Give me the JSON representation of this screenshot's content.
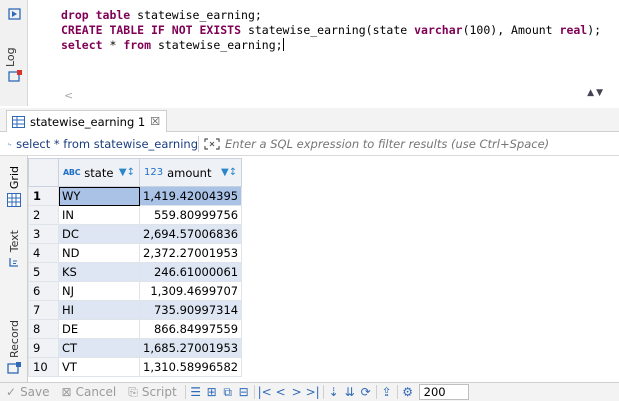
{
  "editor": {
    "lines": [
      [
        {
          "t": "drop table",
          "k": true
        },
        {
          "t": " statewise_earning;",
          "k": false
        }
      ],
      [
        {
          "t": "CREATE TABLE IF NOT EXISTS",
          "k": true
        },
        {
          "t": " statewise_earning(state ",
          "k": false
        },
        {
          "t": "varchar",
          "k": true
        },
        {
          "t": "(100), Amount ",
          "k": false
        },
        {
          "t": "real",
          "k": true
        },
        {
          "t": ");",
          "k": false
        }
      ],
      [
        {
          "t": "select",
          "k": true
        },
        {
          "t": " * ",
          "k": false
        },
        {
          "t": "from",
          "k": true
        },
        {
          "t": " statewise_earning;",
          "k": false
        }
      ]
    ],
    "log_tab": "Log"
  },
  "result_tab": {
    "label": "statewise_earning 1",
    "close_icon": "close-icon"
  },
  "filter_bar": {
    "query": "select * from statewise_earning",
    "placeholder": "Enter a SQL expression to filter results (use Ctrl+Space)"
  },
  "side_tabs": {
    "grid": "Grid",
    "text": "Text",
    "record": "Record"
  },
  "grid": {
    "columns": [
      {
        "type_badge": "ABC",
        "name": "state"
      },
      {
        "type_badge": "123",
        "name": "amount"
      }
    ],
    "rows": [
      {
        "n": "1",
        "state": "WY",
        "amount": "1,419.42004395"
      },
      {
        "n": "2",
        "state": "IN",
        "amount": "559.80999756"
      },
      {
        "n": "3",
        "state": "DC",
        "amount": "2,694.57006836"
      },
      {
        "n": "4",
        "state": "ND",
        "amount": "2,372.27001953"
      },
      {
        "n": "5",
        "state": "KS",
        "amount": "246.61000061"
      },
      {
        "n": "6",
        "state": "NJ",
        "amount": "1,309.4699707"
      },
      {
        "n": "7",
        "state": "HI",
        "amount": "735.90997314"
      },
      {
        "n": "8",
        "state": "DE",
        "amount": "866.84997559"
      },
      {
        "n": "9",
        "state": "CT",
        "amount": "1,685.27001953"
      },
      {
        "n": "10",
        "state": "VT",
        "amount": "1,310.58996582"
      }
    ]
  },
  "bottom_bar": {
    "save": "Save",
    "cancel": "Cancel",
    "script": "Script",
    "fetch_size": "200"
  },
  "colors": {
    "keyword": "#7f0055",
    "selected_cell": "#a9c2e6",
    "alt_row": "#dde6f2"
  }
}
